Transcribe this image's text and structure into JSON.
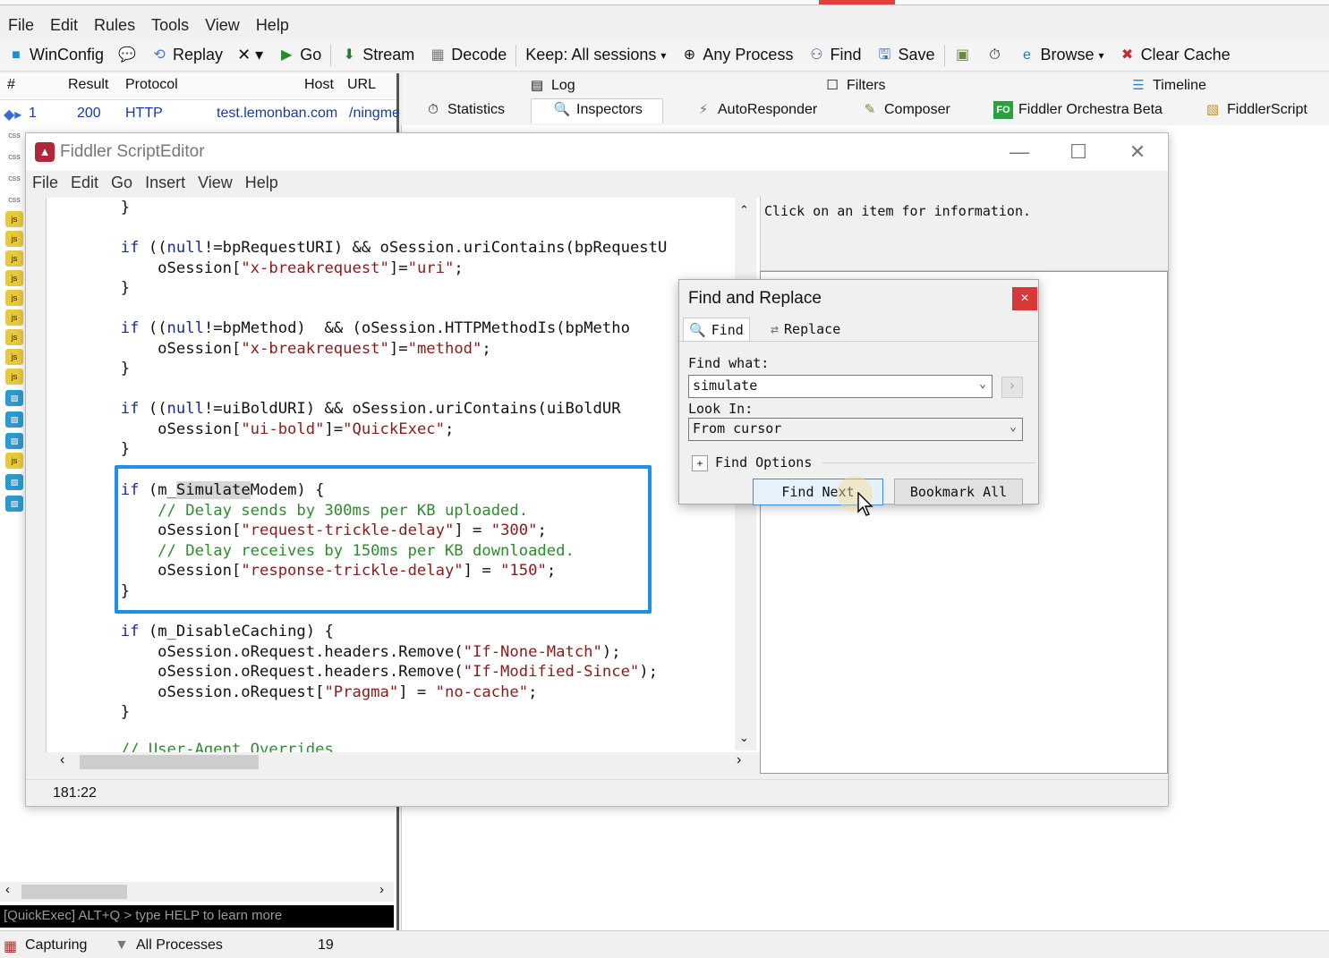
{
  "menubar": [
    "File",
    "Edit",
    "Rules",
    "Tools",
    "View",
    "Help"
  ],
  "toolbar": {
    "winconfig": "WinConfig",
    "replay": "Replay",
    "remove": "✕ ▾",
    "go": "Go",
    "stream": "Stream",
    "decode": "Decode",
    "keep": "Keep: All sessions",
    "any_process": "Any Process",
    "find": "Find",
    "save": "Save",
    "browse": "Browse",
    "clear_cache": "Clear Cache"
  },
  "sessions": {
    "columns": [
      "#",
      "Result",
      "Protocol",
      "Host",
      "URL"
    ],
    "row1": {
      "num": "1",
      "result": "200",
      "protocol": "HTTP",
      "host": "test.lemonban.com",
      "url": "/ningme"
    },
    "quickexec": "[QuickExec] ALT+Q > type HELP to learn more"
  },
  "right_tabs": {
    "log": "Log",
    "filters": "Filters",
    "timeline": "Timeline",
    "statistics": "Statistics",
    "inspectors": "Inspectors",
    "autoresponder": "AutoResponder",
    "composer": "Composer",
    "orchestra": "Fiddler Orchestra Beta",
    "fiddlerscript": "FiddlerScript"
  },
  "status": {
    "capturing": "Capturing",
    "processes": "All Processes",
    "count": "19"
  },
  "script_editor": {
    "title": "Fiddler ScriptEditor",
    "menu": [
      "File",
      "Edit",
      "Go",
      "Insert",
      "View",
      "Help"
    ],
    "info_text": "Click on an item for information.",
    "cursor_pos": "181:22",
    "code": {
      "l0": "        }",
      "l1a": "        ",
      "l1_if": "if",
      "l1b": " ((",
      "l1_null": "null",
      "l1c": "!=bpRequestURI) && oSession.uriContains(bpRequestU",
      "l2a": "            oSession[",
      "l2_s1": "\"x-breakrequest\"",
      "l2b": "]=",
      "l2_s2": "\"uri\"",
      "l2c": ";",
      "l3": "        }",
      "l4a": "        ",
      "l4_if": "if",
      "l4b": " ((",
      "l4_null": "null",
      "l4c": "!=bpMethod)  && (oSession.HTTPMethodIs(bpMetho",
      "l5a": "            oSession[",
      "l5_s1": "\"x-breakrequest\"",
      "l5b": "]=",
      "l5_s2": "\"method\"",
      "l5c": ";",
      "l6": "        }",
      "l7a": "        ",
      "l7_if": "if",
      "l7b": " ((",
      "l7_null": "null",
      "l7c": "!=uiBoldURI) && oSession.uriContains(uiBoldUR",
      "l8a": "            oSession[",
      "l8_s1": "\"ui-bold\"",
      "l8b": "]=",
      "l8_s2": "\"QuickExec\"",
      "l8c": ";",
      "l9": "        }",
      "l10a": "        ",
      "l10_if": "if",
      "l10b": " (m_",
      "l10_sel": "Simulate",
      "l10c": "Modem) {",
      "l11": "            // Delay sends by 300ms per KB uploaded.",
      "l12a": "            oSession[",
      "l12_s1": "\"request-trickle-delay\"",
      "l12b": "] = ",
      "l12_s2": "\"300\"",
      "l12c": ";",
      "l13": "            // Delay receives by 150ms per KB downloaded.",
      "l14a": "            oSession[",
      "l14_s1": "\"response-trickle-delay\"",
      "l14b": "] = ",
      "l14_s2": "\"150\"",
      "l14c": ";",
      "l15": "        }",
      "l16a": "        ",
      "l16_if": "if",
      "l16b": " (m_DisableCaching) {",
      "l17a": "            oSession.oRequest.headers.Remove(",
      "l17_s": "\"If-None-Match\"",
      "l17b": ");",
      "l18a": "            oSession.oRequest.headers.Remove(",
      "l18_s": "\"If-Modified-Since\"",
      "l18b": ");",
      "l19a": "            oSession.oRequest[",
      "l19_s1": "\"Pragma\"",
      "l19b": "] = ",
      "l19_s2": "\"no-cache\"",
      "l19c": ";",
      "l20": "        }",
      "l21": "        // User-Agent Overrides"
    }
  },
  "find_dialog": {
    "title": "Find and Replace",
    "close": "×",
    "tab_find": "Find",
    "tab_replace": "Replace",
    "find_what_label": "Find what:",
    "find_what_value": "simulate",
    "look_in_label": "Look In:",
    "look_in_value": "From cursor",
    "find_options": "Find Options",
    "find_next": "Find Next",
    "bookmark_all": "Bookmark All"
  }
}
